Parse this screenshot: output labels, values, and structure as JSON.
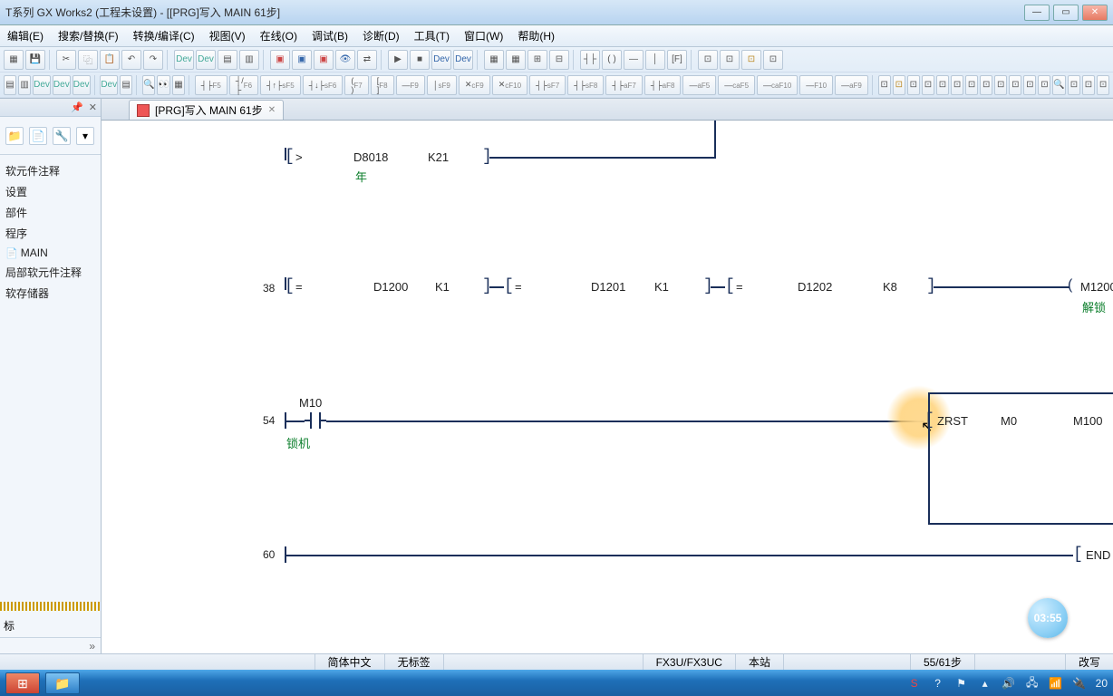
{
  "window": {
    "title": "T系列 GX Works2 (工程未设置) - [[PRG]写入 MAIN 61步]"
  },
  "menu": {
    "edit": "编辑(E)",
    "find": "搜索/替换(F)",
    "convert": "转换/编译(C)",
    "view": "视图(V)",
    "online": "在线(O)",
    "debug": "调试(B)",
    "diag": "诊断(D)",
    "tool": "工具(T)",
    "window": "窗口(W)",
    "help": "帮助(H)"
  },
  "tab": {
    "label": "[PRG]写入 MAIN 61步"
  },
  "left_panel": {
    "items": [
      "软元件注释",
      "设置",
      "部件",
      "程序",
      "MAIN",
      "局部软元件注释",
      "软存储器"
    ],
    "bottom": "标"
  },
  "ladder": {
    "rung0": {
      "op": ">",
      "d": "D8018",
      "k": "K21",
      "comment": "年"
    },
    "rung1": {
      "step": "38",
      "cmp1": {
        "op": "=",
        "d": "D1200",
        "k": "K1"
      },
      "cmp2": {
        "op": "=",
        "d": "D1201",
        "k": "K1"
      },
      "cmp3": {
        "op": "=",
        "d": "D1202",
        "k": "K8"
      },
      "coil": "M1200",
      "comment": "解锁"
    },
    "rung2": {
      "step": "54",
      "contact": "M10",
      "comment": "锁机",
      "inst": "ZRST",
      "op1": "M0",
      "op2": "M100"
    },
    "rung3": {
      "step": "60",
      "inst": "END"
    }
  },
  "status": {
    "lang": "简体中文",
    "tag": "无标签",
    "plc": "FX3U/FX3UC",
    "host": "本站",
    "steps": "55/61步",
    "mode": "改写",
    "extra": "20"
  },
  "bubble": "03:55"
}
